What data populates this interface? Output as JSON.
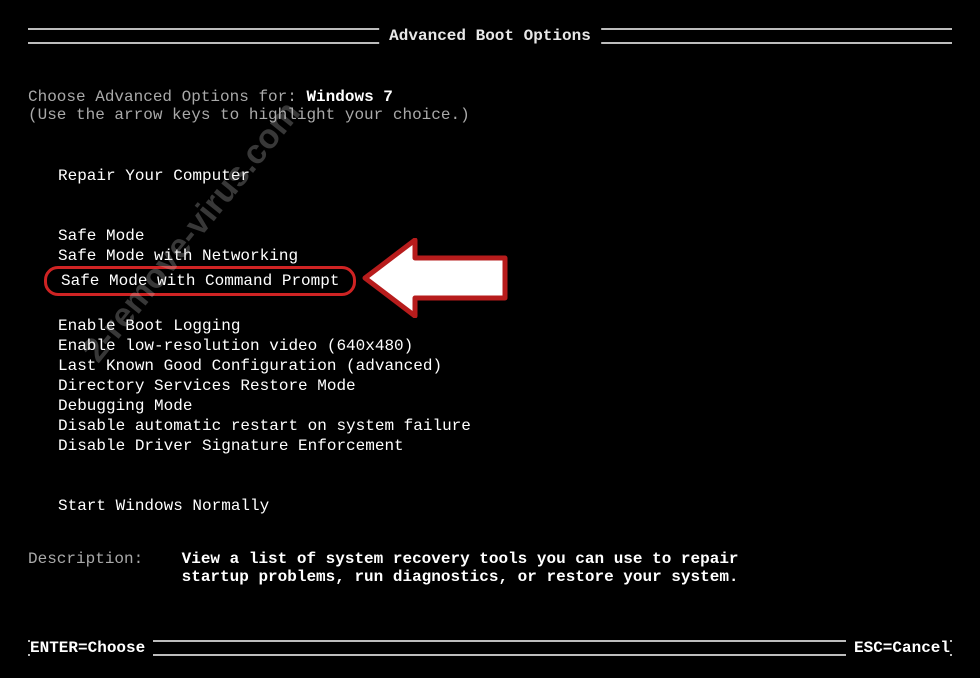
{
  "title": "Advanced Boot Options",
  "intro_prefix": "Choose Advanced Options for: ",
  "os_name": "Windows 7",
  "intro_hint": "(Use the arrow keys to highlight your choice.)",
  "menu": {
    "group1": [
      "Repair Your Computer"
    ],
    "group2": [
      "Safe Mode",
      "Safe Mode with Networking",
      "Safe Mode with Command Prompt"
    ],
    "group3": [
      "Enable Boot Logging",
      "Enable low-resolution video (640x480)",
      "Last Known Good Configuration (advanced)",
      "Directory Services Restore Mode",
      "Debugging Mode",
      "Disable automatic restart on system failure",
      "Disable Driver Signature Enforcement"
    ],
    "group4": [
      "Start Windows Normally"
    ],
    "highlighted_index": {
      "group": "group2",
      "i": 2
    }
  },
  "description": {
    "label": "Description:",
    "line1": "View a list of system recovery tools you can use to repair",
    "line2": "startup problems, run diagnostics, or restore your system."
  },
  "footer": {
    "enter": "ENTER=Choose",
    "esc": "ESC=Cancel"
  },
  "watermark": "2-remove-virus.com"
}
